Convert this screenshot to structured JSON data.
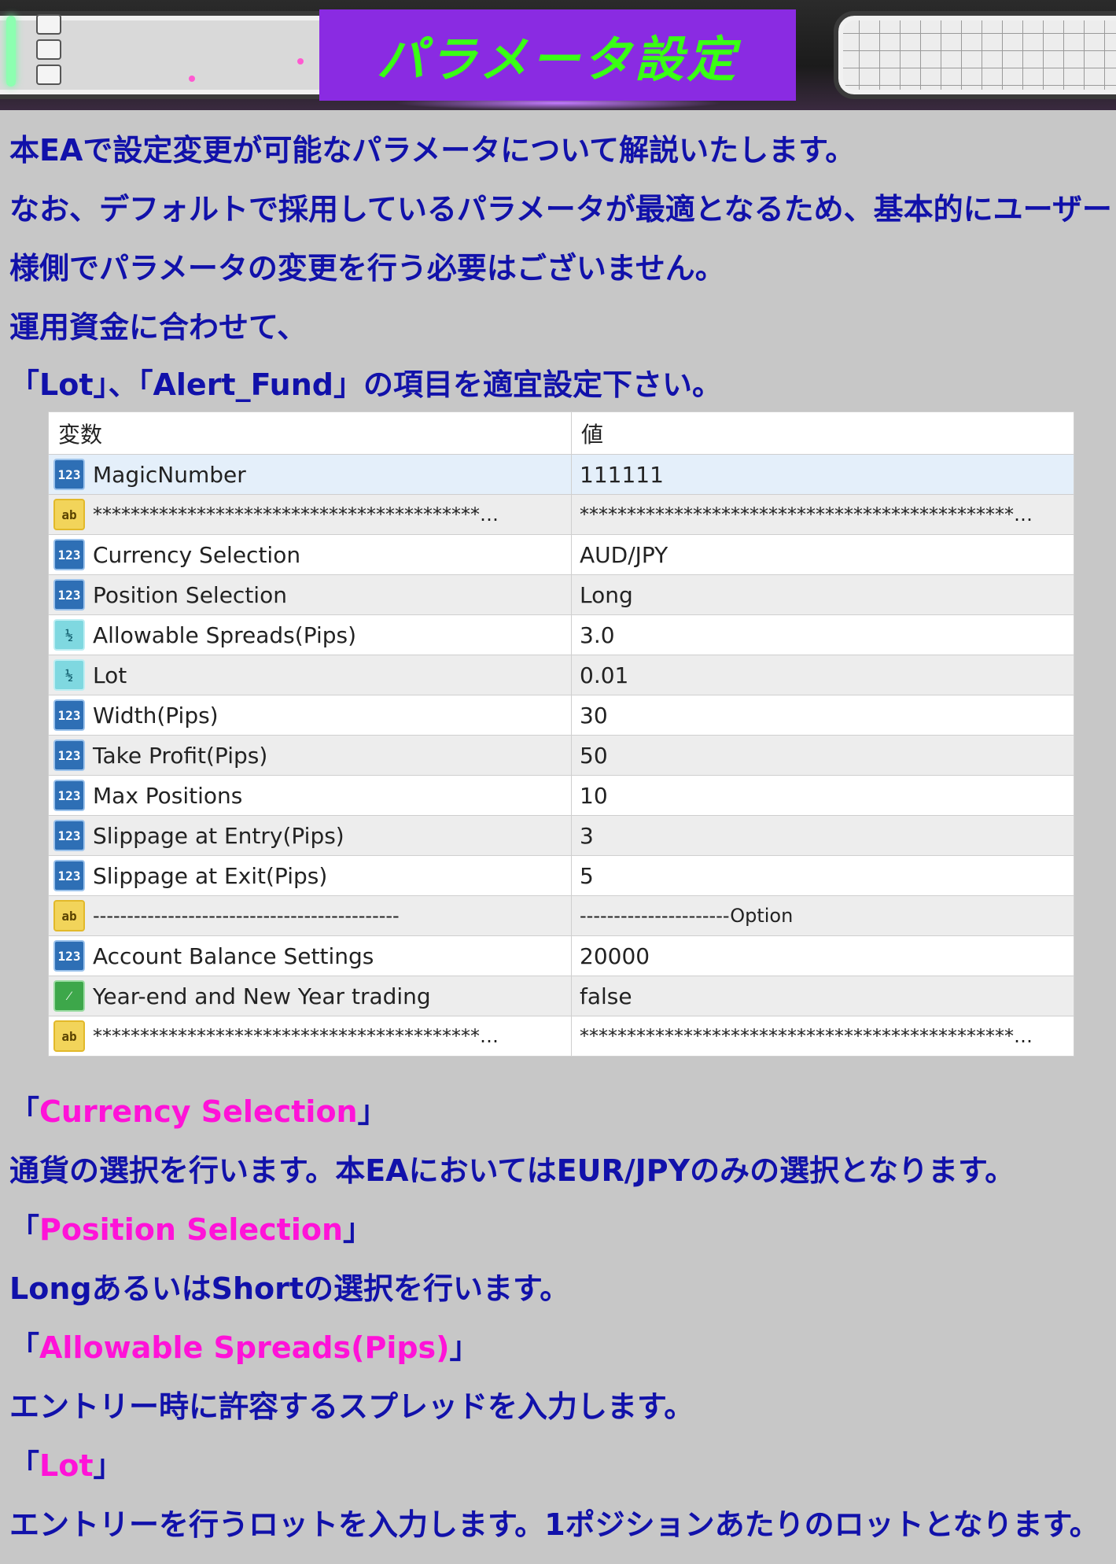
{
  "banner": {
    "title": "パラメータ設定"
  },
  "intro": {
    "line1": "本EAで設定変更が可能なパラメータについて解説いたします。",
    "line2": "なお、デフォルトで採用しているパラメータが最適となるため、基本的にユーザー",
    "line3": "様側でパラメータの変更を行う必要はございません。",
    "line4": "運用資金に合わせて、",
    "line5": "「Lot」、「Alert_Fund」の項目を適宜設定下さい。"
  },
  "table": {
    "header_variable": "変数",
    "header_value": "値",
    "rows": [
      {
        "icon": "123",
        "name": "MagicNumber",
        "value": "111111"
      },
      {
        "icon": "ab",
        "name": "*****************************************…",
        "value": "**********************************************…"
      },
      {
        "icon": "123",
        "name": "Currency Selection",
        "value": "AUD/JPY"
      },
      {
        "icon": "123",
        "name": "Position Selection",
        "value": "Long"
      },
      {
        "icon": "1/2",
        "name": "Allowable Spreads(Pips)",
        "value": "3.0"
      },
      {
        "icon": "1/2",
        "name": "Lot",
        "value": "0.01"
      },
      {
        "icon": "123",
        "name": "Width(Pips)",
        "value": "30"
      },
      {
        "icon": "123",
        "name": "Take Profit(Pips)",
        "value": "50"
      },
      {
        "icon": "123",
        "name": "Max Positions",
        "value": "10"
      },
      {
        "icon": "123",
        "name": "Slippage at Entry(Pips)",
        "value": "3"
      },
      {
        "icon": "123",
        "name": "Slippage at Exit(Pips)",
        "value": "5"
      },
      {
        "icon": "ab",
        "name": "---------------------------------------------",
        "value": "----------------------Option"
      },
      {
        "icon": "123",
        "name": "Account Balance Settings",
        "value": "20000"
      },
      {
        "icon": "bool",
        "name": "Year-end and New Year trading",
        "value": "false"
      },
      {
        "icon": "ab",
        "name": "*****************************************…",
        "value": "**********************************************…"
      }
    ]
  },
  "sections": [
    {
      "heading": "Currency Selection",
      "text": "通貨の選択を行います。本EAにおいてはEUR/JPYのみの選択となります。"
    },
    {
      "heading": "Position Selection",
      "text": "LongあるいはShortの選択を行います。"
    },
    {
      "heading": "Allowable Spreads(Pips)",
      "text": "エントリー時に許容するスプレッドを入力します。"
    },
    {
      "heading": "Lot",
      "text": "エントリーを行うロットを入力します。1ポジションあたりのロットとなります。"
    }
  ],
  "brackets": {
    "open": "「",
    "close": "」"
  },
  "colors": {
    "heading": "#ff12d8",
    "text": "#1111aa",
    "banner": "#8a2be2",
    "banner_text": "#39ff14"
  }
}
